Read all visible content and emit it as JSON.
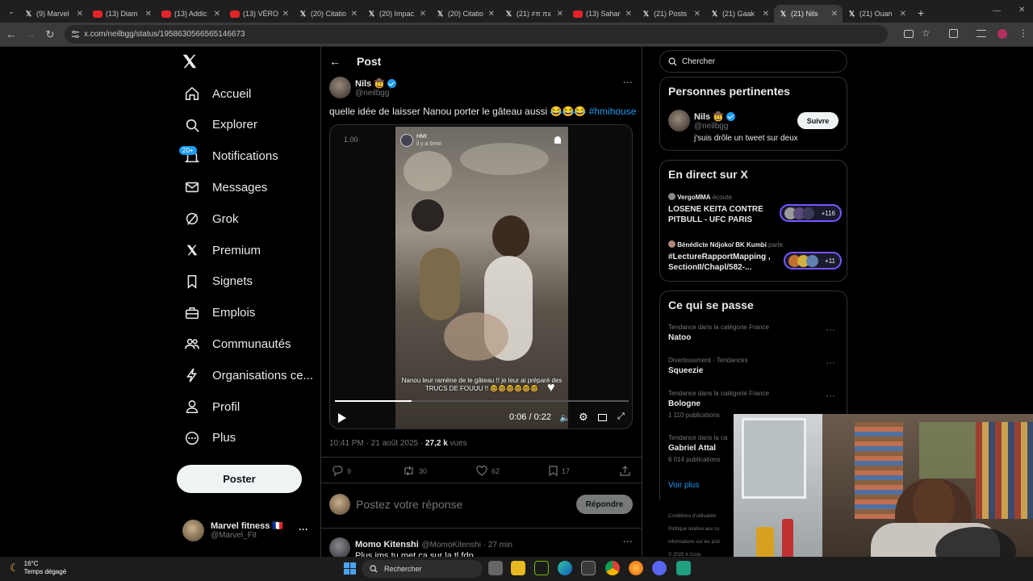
{
  "browser": {
    "tabs": [
      {
        "label": "(9) Marvel",
        "favicon": "x-icon"
      },
      {
        "label": "(13) Diam",
        "favicon": "youtube-icon"
      },
      {
        "label": "(13) Addic",
        "favicon": "youtube-icon"
      },
      {
        "label": "(13) VÉRO",
        "favicon": "youtube-icon"
      },
      {
        "label": "(20) Citatio",
        "favicon": "x-icon"
      },
      {
        "label": "(20) Impac",
        "favicon": "x-icon"
      },
      {
        "label": "(20) Citatio",
        "favicon": "x-icon"
      },
      {
        "label": "(21) ≠π πx",
        "favicon": "x-icon"
      },
      {
        "label": "(13) Sahar",
        "favicon": "youtube-icon"
      },
      {
        "label": "(21) Posts",
        "favicon": "x-icon"
      },
      {
        "label": "(21) Gaak",
        "favicon": "x-icon"
      },
      {
        "label": "(21) Nils",
        "favicon": "x-icon",
        "active": true
      },
      {
        "label": "(21) Ouan",
        "favicon": "x-icon"
      }
    ],
    "url": "x.com/neilbgg/status/1958630566565146673"
  },
  "nav": {
    "items": [
      {
        "label": "Accueil",
        "icon": "home-icon"
      },
      {
        "label": "Explorer",
        "icon": "search-icon"
      },
      {
        "label": "Notifications",
        "icon": "bell-icon"
      },
      {
        "label": "Messages",
        "icon": "mail-icon"
      },
      {
        "label": "Grok",
        "icon": "grok-icon"
      },
      {
        "label": "Premium",
        "icon": "x-icon"
      },
      {
        "label": "Signets",
        "icon": "bookmark-icon"
      },
      {
        "label": "Emplois",
        "icon": "briefcase-icon"
      },
      {
        "label": "Communautés",
        "icon": "people-icon"
      },
      {
        "label": "Organisations ce...",
        "icon": "bolt-icon"
      },
      {
        "label": "Profil",
        "icon": "person-icon"
      },
      {
        "label": "Plus",
        "icon": "more-circle-icon"
      }
    ],
    "notif_badge": "20+",
    "post_button": "Poster",
    "me": {
      "name": "Marvel fitness 🇫🇷",
      "handle": "@Marvel_Fit"
    }
  },
  "post": {
    "header": "Post",
    "author": {
      "name": "Nils 🤠",
      "handle": "@neilbgg"
    },
    "text": "quelle idée de laisser Nanou porter le gâteau aussi 😂😂😂",
    "hashtag": "#hmihouse",
    "video": {
      "speed": "1.00",
      "overlay_account": "HMI",
      "overlay_age": "il y a 6min",
      "caption": "Nanou leur ramène de le gâteau !! je leur ai préparé des TRUCS DE FOUUU !! 🤓🤓🤓🤓🤓🤓",
      "time": "0:06 / 0:22",
      "progress": 0.26
    },
    "timestamp": "10:41 PM · 21 août 2025 · ",
    "views_count": "27,2 k",
    "views_label": " vues",
    "stats": {
      "replies": "9",
      "reposts": "30",
      "likes": "62",
      "bookmarks": "17"
    },
    "reply_placeholder": "Postez votre réponse",
    "reply_button": "Répondre"
  },
  "reply": {
    "name": "Momo Kitenshi",
    "handle": "@MomoKitenshi · 27 min",
    "text": "Plus ims tu met ca sur la tl fdp"
  },
  "sidebar": {
    "search_placeholder": "Chercher",
    "relevant": {
      "title": "Personnes pertinentes",
      "name": "Nils 🤠",
      "handle": "@neilbgg",
      "bio": "j'suis drôle un tweet sur deux",
      "follow": "Suivre"
    },
    "live": {
      "title": "En direct sur X",
      "items": [
        {
          "host": "VergoMMA",
          "verb": "écoute.",
          "title": "LOSENE KEITA CONTRE PITBULL - UFC PARIS",
          "count": "+116"
        },
        {
          "host": "Bénédicte Ndjoko/ BK Kumbi",
          "verb": "parle.",
          "title": "#LectureRapportMapping , SectionII/Chapl/582-...",
          "count": "+11"
        }
      ]
    },
    "trends": {
      "title": "Ce qui se passe",
      "items": [
        {
          "category": "Tendance dans la catégorie France",
          "name": "Natoo",
          "count": ""
        },
        {
          "category": "Divertissement · Tendances",
          "name": "Squeezie",
          "count": ""
        },
        {
          "category": "Tendance dans la catégorie France",
          "name": "Bologne",
          "count": "1 110 publications"
        },
        {
          "category": "Tendance dans la ca",
          "name": "Gabriel Attal",
          "count": "6 014 publications"
        }
      ],
      "see_more": "Voir plus"
    },
    "footer": [
      "Conditions d'utilisation",
      "Politique relative aux co",
      "informations sur les pub",
      "© 2025 X Corp."
    ]
  },
  "taskbar": {
    "temp": "16°C",
    "weather": "Temps dégagé",
    "search": "Rechercher"
  }
}
